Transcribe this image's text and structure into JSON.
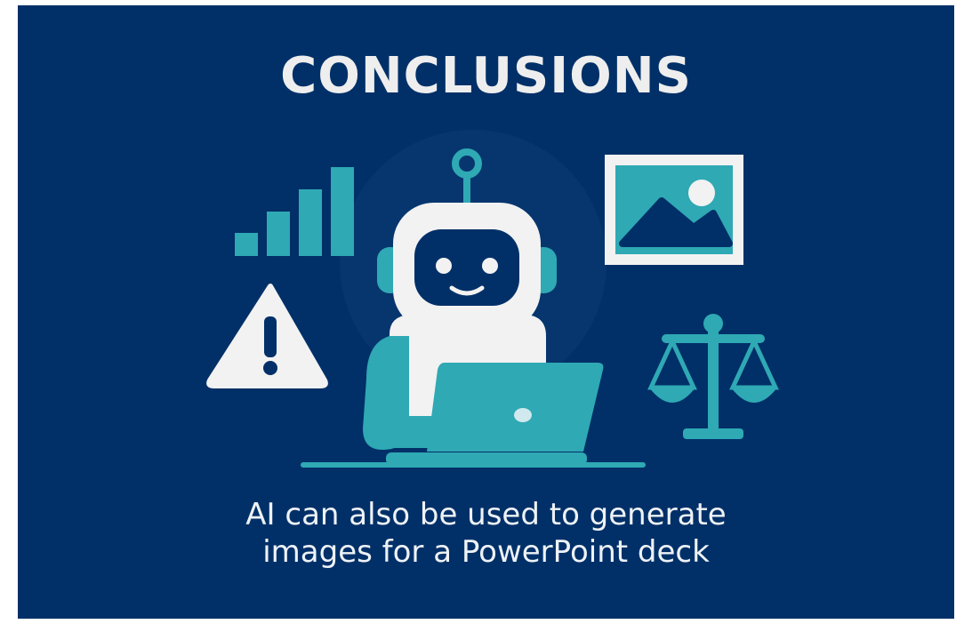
{
  "slide": {
    "title": "CONCLUSIONS",
    "caption": {
      "line1": "AI can also be used to generate",
      "line2": "images for a PowerPoint deck"
    }
  },
  "colors": {
    "background": "#013068",
    "accent_teal": "#2fa9b4",
    "light": "#eeeeee",
    "dark_navy": "#013068"
  },
  "icons": [
    "bar-chart-icon",
    "warning-triangle-icon",
    "robot-icon",
    "laptop-icon",
    "image-frame-icon",
    "scales-of-justice-icon"
  ]
}
